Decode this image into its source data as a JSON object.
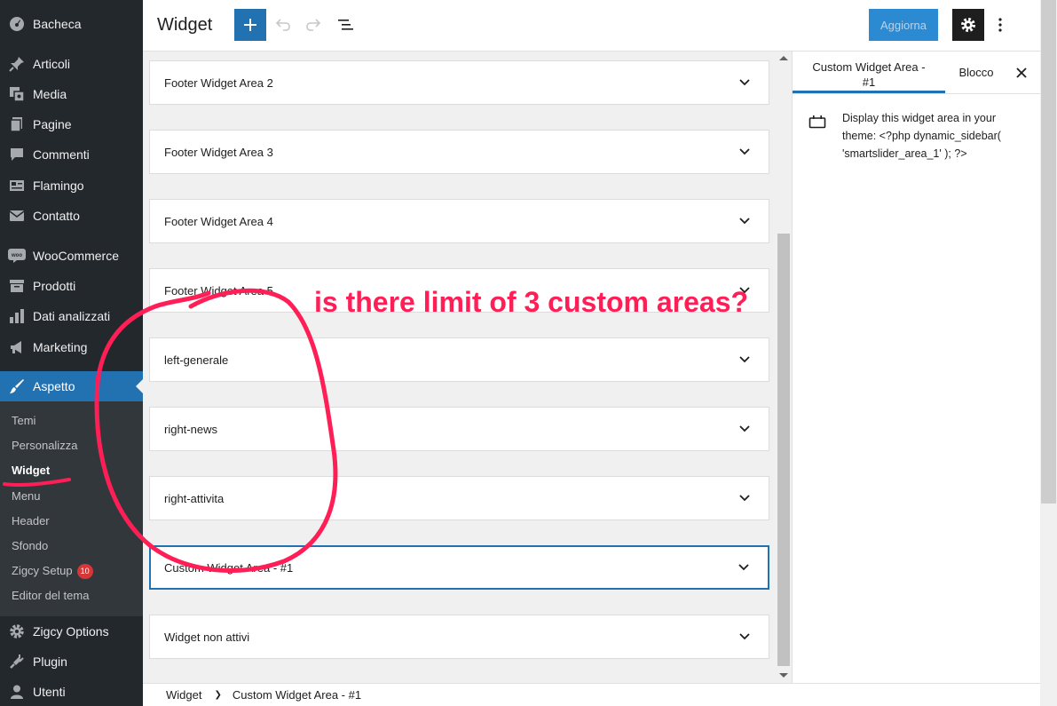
{
  "admin_menu": {
    "items": [
      {
        "label": "Bacheca",
        "icon": "dashboard-icon"
      },
      {
        "label": "Articoli",
        "icon": "pin-icon"
      },
      {
        "label": "Media",
        "icon": "media-icon"
      },
      {
        "label": "Pagine",
        "icon": "pages-icon"
      },
      {
        "label": "Commenti",
        "icon": "comments-icon"
      },
      {
        "label": "Flamingo",
        "icon": "flamingo-icon"
      },
      {
        "label": "Contatto",
        "icon": "mail-icon"
      },
      {
        "label": "WooCommerce",
        "icon": "woocommerce-icon"
      },
      {
        "label": "Prodotti",
        "icon": "archive-icon"
      },
      {
        "label": "Dati analizzati",
        "icon": "bar-chart-icon"
      },
      {
        "label": "Marketing",
        "icon": "megaphone-icon"
      },
      {
        "label": "Aspetto",
        "icon": "brush-icon"
      },
      {
        "label": "Zigcy Options",
        "icon": "gear-icon"
      },
      {
        "label": "Plugin",
        "icon": "plugin-icon"
      },
      {
        "label": "Utenti",
        "icon": "user-icon"
      }
    ],
    "submenu": [
      {
        "label": "Temi"
      },
      {
        "label": "Personalizza"
      },
      {
        "label": "Widget"
      },
      {
        "label": "Menu"
      },
      {
        "label": "Header"
      },
      {
        "label": "Sfondo"
      },
      {
        "label": "Zigcy Setup",
        "badge": "10"
      },
      {
        "label": "Editor del tema"
      }
    ]
  },
  "header": {
    "title": "Widget",
    "update_label": "Aggiorna"
  },
  "widget_areas": [
    {
      "label": "Footer Widget Area 2"
    },
    {
      "label": "Footer Widget Area 3"
    },
    {
      "label": "Footer Widget Area 4"
    },
    {
      "label": "Footer Widget Area 5"
    },
    {
      "label": "left-generale"
    },
    {
      "label": "right-news"
    },
    {
      "label": "right-attivita"
    },
    {
      "label": "Custom Widget Area - #1"
    },
    {
      "label": "Widget non attivi"
    }
  ],
  "inspector": {
    "tab_area_line1": "Custom Widget Area -",
    "tab_area_line2": "#1",
    "tab_block": "Blocco",
    "description": "Display this widget area in your theme: <?php dynamic_sidebar( 'smartslider_area_1' ); ?>"
  },
  "breadcrumb": {
    "root": "Widget",
    "current": "Custom Widget Area - #1"
  },
  "annotation": {
    "text": "is there limit of 3 custom areas?",
    "color": "#ff1e55"
  },
  "colors": {
    "sidebar_bg": "#23282d",
    "accent": "#2271b1"
  }
}
